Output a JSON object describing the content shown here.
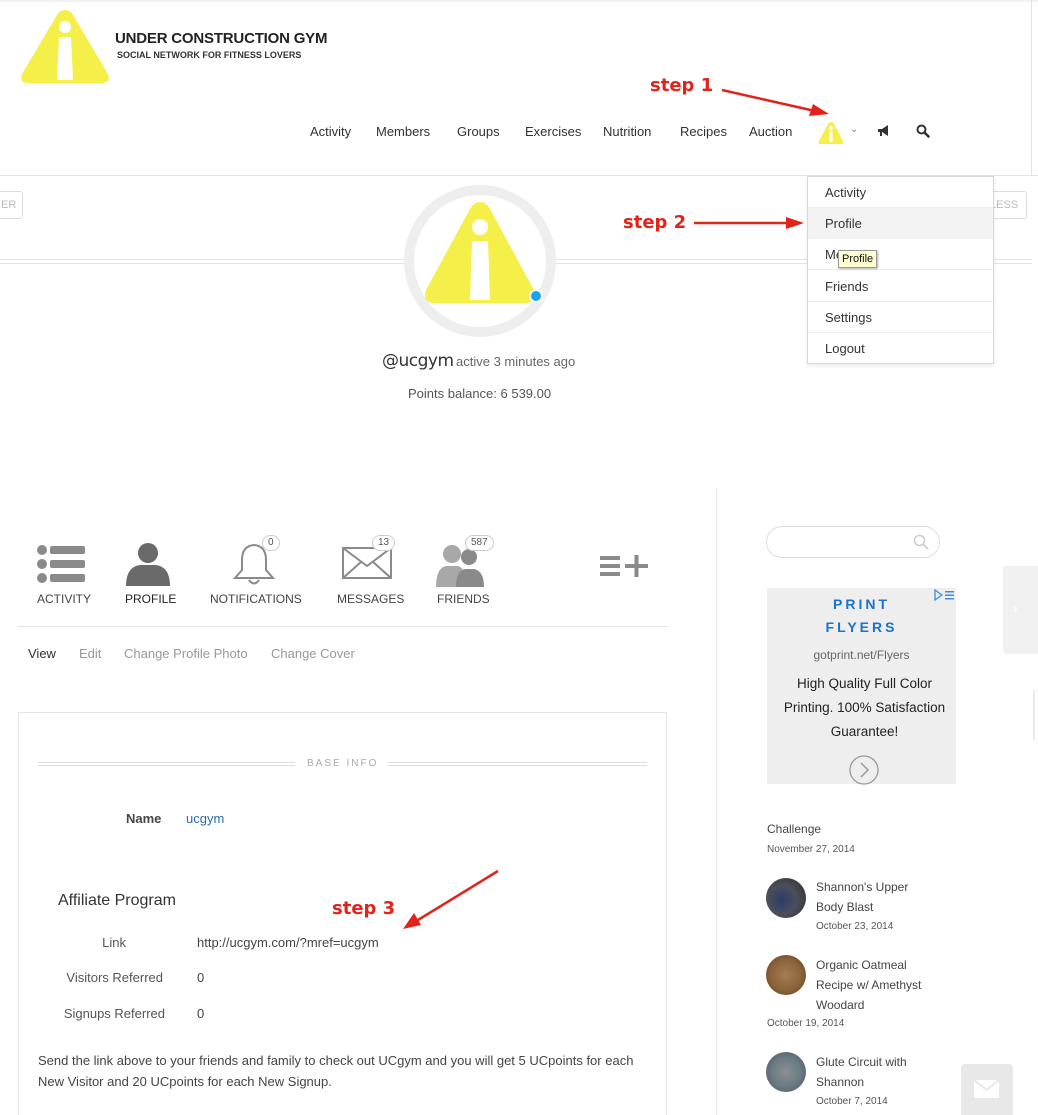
{
  "site": {
    "title": "UNDER CONSTRUCTION GYM",
    "tagline": "SOCIAL NETWORK FOR FITNESS LOVERS"
  },
  "nav": {
    "items": [
      "Activity",
      "Members",
      "Groups",
      "Exercises",
      "Nutrition",
      "Recipes",
      "Auction"
    ],
    "avatar_icon": "user-avatar-warning-icon",
    "chevron": "⌄"
  },
  "annotations": {
    "step1": "step 1",
    "step2": "step 2",
    "step3": "step 3",
    "color": "#e2231a"
  },
  "dropdown": {
    "items": [
      "Activity",
      "Profile",
      "Messages",
      "Friends",
      "Settings",
      "Logout"
    ],
    "visible_items": [
      "Activity",
      "Profile",
      "Me",
      "Friends",
      "Settings",
      "Logout"
    ],
    "tooltip": "Profile"
  },
  "header_band": {
    "ghost_left": "ER",
    "ghost_right": "LESS"
  },
  "profile": {
    "username": "@ucgym",
    "activity": "active 3 minutes ago",
    "points": "Points balance: 6 539.00",
    "online_color": "#1da1f2"
  },
  "tabs": [
    {
      "label": "ACTIVITY",
      "icon": "list-icon"
    },
    {
      "label": "PROFILE",
      "icon": "person-icon"
    },
    {
      "label": "NOTIFICATIONS",
      "icon": "bell-icon",
      "count": "0"
    },
    {
      "label": "MESSAGES",
      "icon": "envelope-icon",
      "count": "13"
    },
    {
      "label": "FRIENDS",
      "icon": "friends-icon",
      "count": "587"
    }
  ],
  "subnav": [
    "View",
    "Edit",
    "Change Profile Photo",
    "Change Cover"
  ],
  "base_info": {
    "heading": "BASE INFO",
    "name_label": "Name",
    "name_value": "ucgym"
  },
  "affiliate": {
    "title": "Affiliate Program",
    "rows": [
      {
        "label": "Link",
        "value": "http://ucgym.com/?mref=ucgym"
      },
      {
        "label": "Visitors Referred",
        "value": "0"
      },
      {
        "label": "Signups Referred",
        "value": "0"
      }
    ],
    "description": "Send the link above to your friends and family to check out UCgym and you will get 5 UCpoints for each New Visitor and 20 UCpoints for each New Signup."
  },
  "sidebar": {
    "search_placeholder": "",
    "ad": {
      "line1": "PRINT",
      "line2": "FLYERS",
      "url": "gotprint.net/Flyers",
      "body": "High Quality Full Color Printing. 100% Satisfaction Guarantee!"
    },
    "challenge": {
      "label": "Challenge",
      "date": "November 27, 2014"
    },
    "posts": [
      {
        "title": "Shannon's Upper Body Blast",
        "date": "October 23, 2014"
      },
      {
        "title": "Organic Oatmeal Recipe w/ Amethyst Woodard",
        "date": "October 19, 2014"
      },
      {
        "title": "Glute Circuit with Shannon",
        "date": "October 7, 2014"
      }
    ]
  },
  "colors": {
    "brand_yellow": "#f5ef4a",
    "link_blue": "#2b6cb0",
    "ad_blue": "#1a73c8"
  }
}
